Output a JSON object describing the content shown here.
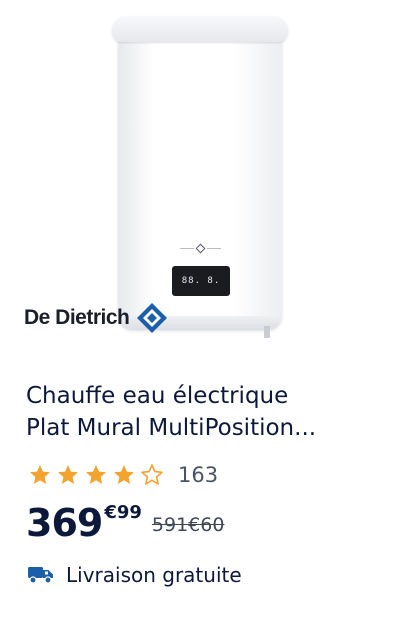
{
  "product": {
    "image_alt": "Chauffe eau électrique Plat Mural MultiPosition",
    "display_reading": "88. 8.",
    "brand": "De Dietrich",
    "title_line1": "Chauffe eau électrique",
    "title_line2": "Plat Mural MultiPosition...",
    "rating": 4,
    "rating_max": 5,
    "review_count": "163",
    "price_main": "369",
    "price_cents": "€99",
    "price_old": "591€60",
    "delivery_label": "Livraison gratuite"
  },
  "colors": {
    "star": "#f2a330",
    "text": "#0c193a",
    "brand_blue": "#1b5faa"
  },
  "icons": {
    "star_filled": "star-filled-icon",
    "star_empty": "star-outline-icon",
    "truck": "truck-icon",
    "brand": "de-dietrich-diamond-icon"
  }
}
